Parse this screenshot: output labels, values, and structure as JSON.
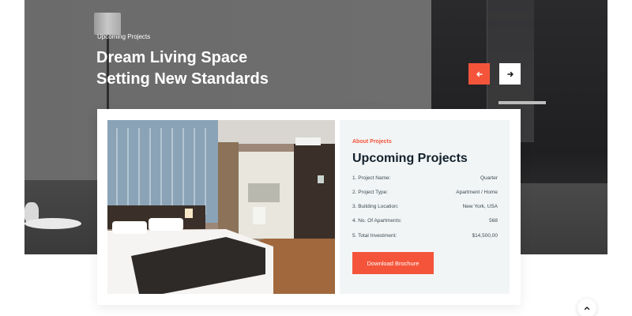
{
  "hero": {
    "eyebrow": "Upcoming Projects",
    "title_line1": "Dream Living Space",
    "title_line2": "Setting New Standards",
    "prev_icon": "arrow-left-icon",
    "next_icon": "arrow-right-icon"
  },
  "project": {
    "eyebrow": "About Projects",
    "title": "Upcoming Projects",
    "details": [
      {
        "label": "1. Project Name:",
        "value": "Quarter"
      },
      {
        "label": "2. Project Type:",
        "value": "Apartment / Home"
      },
      {
        "label": "3. Building Location:",
        "value": "New York, USA"
      },
      {
        "label": "4. No. Of Apartments:",
        "value": "568"
      },
      {
        "label": "5. Total Investment:",
        "value": "$14,500,00"
      }
    ],
    "button_label": "Download Brochure"
  },
  "colors": {
    "accent": "#f4553a",
    "heading": "#12212b",
    "panel": "#f2f5f6"
  },
  "scroll_top_icon": "chevron-up-icon"
}
